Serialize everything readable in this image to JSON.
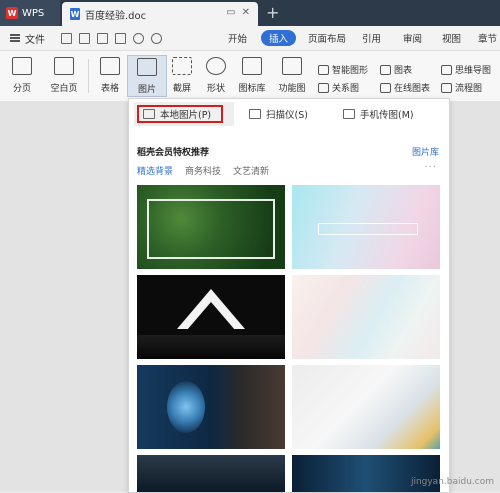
{
  "titlebar": {
    "app_name": "WPS",
    "doc_tab": "百度经验.doc"
  },
  "menubar": {
    "file": "文件",
    "tabs": [
      "开始",
      "插入",
      "页面布局",
      "引用",
      "审阅",
      "视图",
      "章节"
    ],
    "active_tab": "插入"
  },
  "ribbon": {
    "buttons": [
      "分页",
      "空白页",
      "表格",
      "图片",
      "截屏",
      "形状",
      "图标库",
      "功能图"
    ],
    "selected": "图片",
    "small": [
      "智能图形",
      "图表",
      "关系图",
      "在线图表",
      "思维导图",
      "流程图"
    ]
  },
  "picture_panel": {
    "sources": [
      "本地图片(P)",
      "扫描仪(S)",
      "手机传图(M)"
    ],
    "highlighted_source": "本地图片(P)",
    "heading": "稻壳会员特权推荐",
    "library_link": "图片库",
    "categories": [
      "精选背景",
      "商务科技",
      "文艺清新"
    ],
    "active_category": "精选背景",
    "more": "···"
  },
  "colors": {
    "accent": "#2f6fd6",
    "highlight_border": "#d21d1d",
    "titlebar": "#2c3a4a"
  },
  "watermark": "jingyan.baidu.com"
}
